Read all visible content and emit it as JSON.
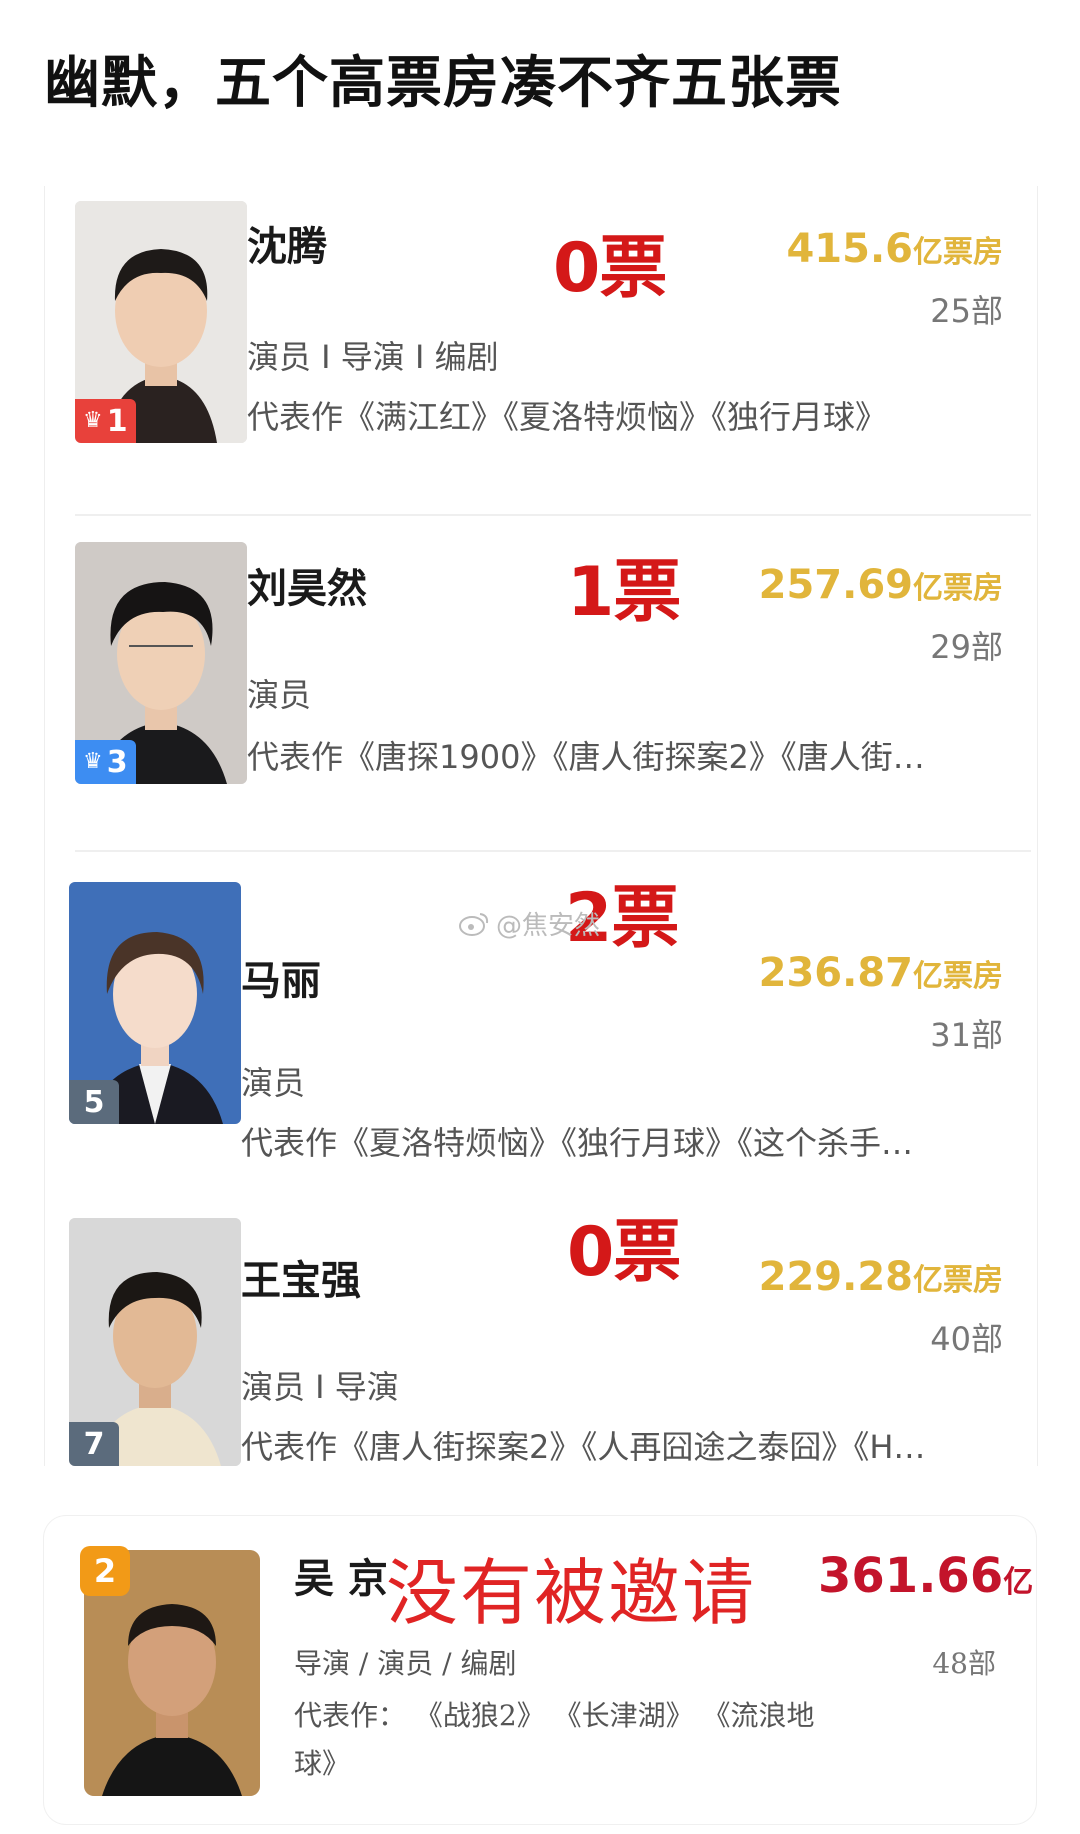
{
  "headline": "幽默，五个高票房凑不齐五张票",
  "watermark": "@焦安然",
  "entries": [
    {
      "name": "沈腾",
      "rank": "1",
      "rank_style": "red",
      "crown": true,
      "votes": "0票",
      "boxoffice_value": "415.6",
      "boxoffice_unit": "亿票房",
      "film_count": "25部",
      "roles": "演员 I 导演 I 编剧",
      "works": "代表作《满江红》《夏洛特烦恼》《独行月球》"
    },
    {
      "name": "刘昊然",
      "rank": "3",
      "rank_style": "blue",
      "crown": true,
      "votes": "1票",
      "boxoffice_value": "257.69",
      "boxoffice_unit": "亿票房",
      "film_count": "29部",
      "roles": "演员",
      "works": "代表作《唐探1900》《唐人街探案2》《唐人街…"
    },
    {
      "name": "马丽",
      "rank": "5",
      "rank_style": "gray",
      "crown": false,
      "votes": "2票",
      "boxoffice_value": "236.87",
      "boxoffice_unit": "亿票房",
      "film_count": "31部",
      "roles": "演员",
      "works": "代表作《夏洛特烦恼》《独行月球》《这个杀手…"
    },
    {
      "name": "王宝强",
      "rank": "7",
      "rank_style": "gray",
      "crown": false,
      "votes": "0票",
      "boxoffice_value": "229.28",
      "boxoffice_unit": "亿票房",
      "film_count": "40部",
      "roles": "演员 I 导演",
      "works": "代表作《唐人街探案2》《人再囧途之泰囧》《H…"
    }
  ],
  "wu": {
    "name": "吴 京",
    "rank": "2",
    "status": "没有被邀请",
    "boxoffice_value": "361.66",
    "boxoffice_unit": "亿",
    "film_count": "48部",
    "roles": "导演 / 演员 / 编剧",
    "works_line1": "代表作：  《战狼2》 《长津湖》 《流浪地",
    "works_line2": "球》"
  },
  "colors": {
    "votes_red": "#d41818",
    "boxoffice_gold": "#e1b53b",
    "not_invited_red": "#e02424",
    "rank_red": "#e8413b",
    "rank_blue": "#3d8df2",
    "rank_gray": "#5b6b7c",
    "rank_gold": "#f29a17"
  }
}
